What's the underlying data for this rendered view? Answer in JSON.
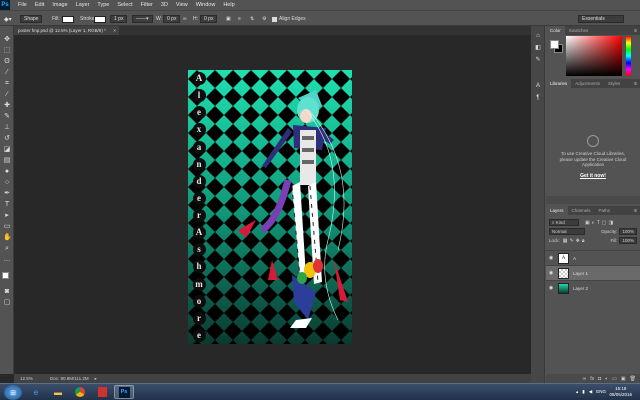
{
  "app": {
    "logo": "Ps"
  },
  "menu": [
    "File",
    "Edit",
    "Image",
    "Layer",
    "Type",
    "Select",
    "Filter",
    "3D",
    "View",
    "Window",
    "Help"
  ],
  "options": {
    "mode_label": "Shape",
    "fill_label": "Fill:",
    "stroke_label": "Stroke:",
    "stroke_width": "1 px",
    "w_label": "W:",
    "w_value": "0 px",
    "h_label": "H:",
    "h_value": "0 px",
    "align_edges": "Align Edges",
    "workspace": "Essentials"
  },
  "document": {
    "tab_title": "poster fmp.psd @ 12.5% (Layer 1, RGB/8) *",
    "zoom": "12.5%",
    "doc_size": "Doc: 90.9M/111.2M",
    "vertical_text": [
      "A",
      "l",
      "e",
      "x",
      "a",
      "n",
      "d",
      "e",
      "r",
      "A",
      "s",
      "h",
      "m",
      "o",
      "r",
      "e"
    ]
  },
  "panels": {
    "color": {
      "tabs": [
        "Color",
        "Swatches"
      ]
    },
    "libraries": {
      "tabs": [
        "Libraries",
        "Adjustments",
        "Styles"
      ],
      "message": "To use Creative Cloud Libraries, please update the Creative Cloud Application",
      "button": "Get it now!"
    },
    "layers": {
      "tabs": [
        "Layers",
        "Channels",
        "Paths"
      ],
      "filter_kind": "Kind",
      "blend_mode": "Normal",
      "opacity_label": "Opacity:",
      "opacity_value": "100%",
      "lock_label": "Lock:",
      "fill_label": "Fill:",
      "fill_value": "100%",
      "items": [
        {
          "name": "A",
          "thumb": "letter",
          "active": false
        },
        {
          "name": "Layer 1",
          "thumb": "figure",
          "active": true
        },
        {
          "name": "Layer 2",
          "thumb": "bg",
          "active": false
        }
      ]
    }
  },
  "taskbar": {
    "language": "ENG",
    "time": "15:18",
    "date": "08/05/2016"
  },
  "colors": {
    "gradient_top": "#1fe0b0",
    "gradient_bottom": "#0b3a30",
    "accent_ps": "#31a8ff"
  }
}
